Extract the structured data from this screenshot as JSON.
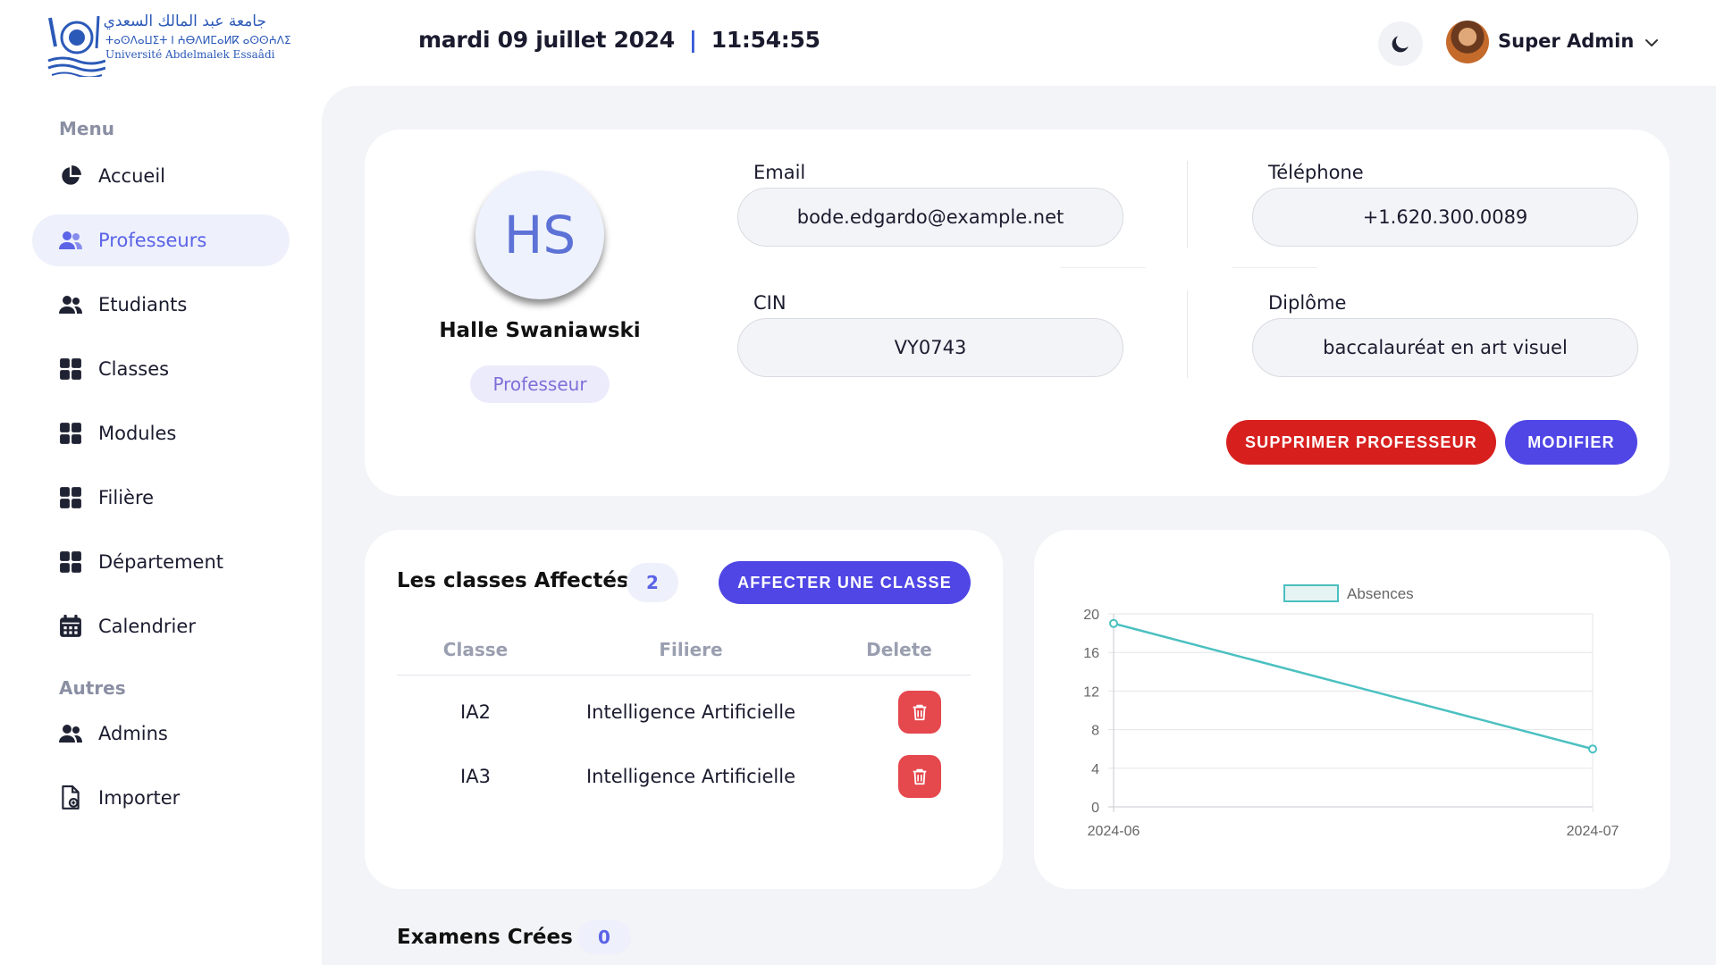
{
  "header": {
    "logo": {
      "arabic": "جامعة عبد المالك السعدي",
      "tifinagh": "ⵜⴰⵙⴷⴰⵡⵉⵜ ⵏ ⵄⴱⴷⵍⵎⴰⵍⴽ ⴰⵙⵙⵄⴷⵉ",
      "latin": "Université Abdelmalek Essaâdi"
    },
    "date": "mardi 09 juillet 2024",
    "separator": "|",
    "time": "11:54:55",
    "user_name": "Super Admin"
  },
  "sidebar": {
    "menu_heading": "Menu",
    "other_heading": "Autres",
    "items": [
      {
        "label": "Accueil",
        "icon": "pie-chart-icon"
      },
      {
        "label": "Professeurs",
        "icon": "users-icon",
        "active": true
      },
      {
        "label": "Etudiants",
        "icon": "users-icon"
      },
      {
        "label": "Classes",
        "icon": "grid-icon"
      },
      {
        "label": "Modules",
        "icon": "grid-icon"
      },
      {
        "label": "Filière",
        "icon": "grid-icon"
      },
      {
        "label": "Département",
        "icon": "grid-icon"
      },
      {
        "label": "Calendrier",
        "icon": "calendar-icon"
      }
    ],
    "other_items": [
      {
        "label": "Admins",
        "icon": "users-icon"
      },
      {
        "label": "Importer",
        "icon": "file-import-icon"
      }
    ]
  },
  "profile": {
    "initials": "HS",
    "name": "Halle Swaniawski",
    "role": "Professeur",
    "email_label": "Email",
    "email": "bode.edgardo@example.net",
    "phone_label": "Téléphone",
    "phone": "+1.620.300.0089",
    "cin_label": "CIN",
    "cin": "VY0743",
    "diploma_label": "Diplôme",
    "diploma": "baccalauréat en art visuel",
    "delete_label": "SUPPRIMER PROFESSEUR",
    "edit_label": "MODIFIER"
  },
  "classes": {
    "title": "Les classes Affectés",
    "count": "2",
    "assign_label": "AFFECTER UNE CLASSE",
    "columns": [
      "Classe",
      "Filiere",
      "Delete"
    ],
    "rows": [
      {
        "classe": "IA2",
        "filiere": "Intelligence Artificielle"
      },
      {
        "classe": "IA3",
        "filiere": "Intelligence Artificielle"
      }
    ]
  },
  "exams": {
    "title": "Examens Crées",
    "count": "0"
  },
  "colors": {
    "accent": "#4f46e5",
    "danger": "#d7201e",
    "chart_line": "#4bc0c0"
  },
  "chart_data": {
    "type": "line",
    "categories": [
      "2024-06",
      "2024-07"
    ],
    "series": [
      {
        "name": "Absences",
        "values": [
          19,
          6
        ]
      }
    ],
    "ylim": [
      0,
      20
    ],
    "yticks": [
      0,
      4,
      8,
      12,
      16,
      20
    ],
    "legend": "top",
    "grid": true
  }
}
